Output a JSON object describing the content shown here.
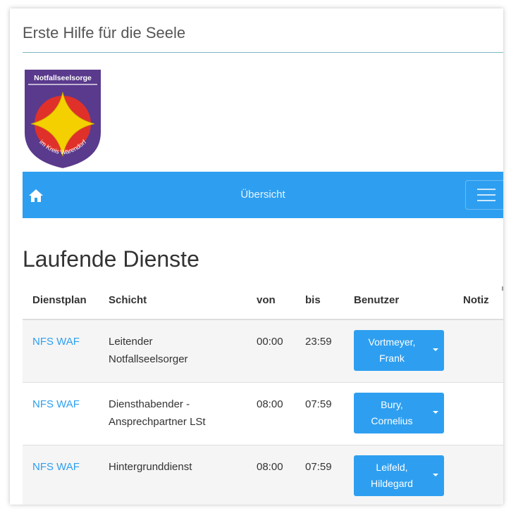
{
  "site": {
    "title": "Erste Hilfe für die Seele"
  },
  "logo": {
    "text_top": "Notfallseelsorge",
    "text_bottom": "im Kreis Warendorf",
    "colors": {
      "shield": "#5a3a8c",
      "ring": "#e0302a",
      "star": "#f5d000"
    }
  },
  "navbar": {
    "title": "Übersicht",
    "home_icon": "home-icon",
    "menu_icon": "hamburger-icon",
    "color": "#2e9ff0"
  },
  "main": {
    "heading": "Laufende Dienste",
    "table": {
      "headers": [
        "Dienstplan",
        "Schicht",
        "von",
        "bis",
        "Benutzer",
        "Notiz"
      ],
      "rows": [
        {
          "plan": "NFS WAF",
          "schicht_1": "Leitender",
          "schicht_2": "Notfallseelsorger",
          "von": "00:00",
          "bis": "23:59",
          "user_1": "Vortmeyer,",
          "user_2": "Frank",
          "notiz": ""
        },
        {
          "plan": "NFS WAF",
          "schicht_1": "Diensthabender -",
          "schicht_2": "Ansprechpartner LSt",
          "von": "08:00",
          "bis": "07:59",
          "user_1": "Bury,",
          "user_2": "Cornelius",
          "notiz": ""
        },
        {
          "plan": "NFS WAF",
          "schicht_1": "Hintergrunddienst",
          "schicht_2": "",
          "von": "08:00",
          "bis": "07:59",
          "user_1": "Leifeld,",
          "user_2": "Hildegard",
          "notiz": ""
        }
      ]
    }
  }
}
